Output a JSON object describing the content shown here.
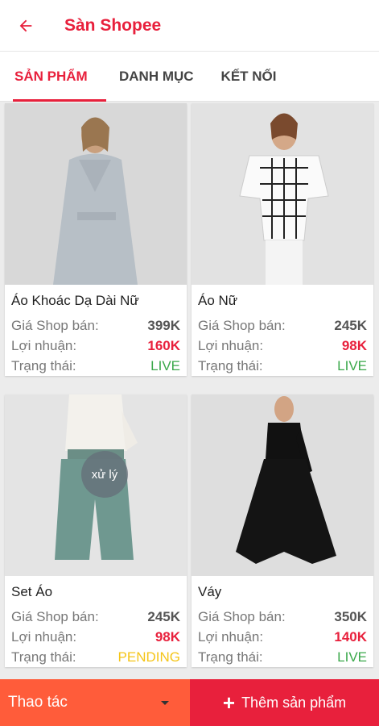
{
  "header": {
    "title": "Sàn Shopee"
  },
  "tabs": [
    {
      "label": "SẢN PHẨM"
    },
    {
      "label": "DANH MỤC"
    },
    {
      "label": "KẾT NỐI"
    }
  ],
  "products": [
    {
      "name": "Áo Khoác Dạ Dài Nữ",
      "price_label": "Giá Shop bán:",
      "price": "399K",
      "profit_label": "Lợi nhuận:",
      "profit": "160K",
      "status_label": "Trạng thái:",
      "status": "LIVE"
    },
    {
      "name": "Áo Nữ",
      "price_label": "Giá Shop bán:",
      "price": "245K",
      "profit_label": "Lợi nhuận:",
      "profit": "98K",
      "status_label": "Trạng thái:",
      "status": "LIVE"
    },
    {
      "name": "Set Áo",
      "price_label": "Giá Shop bán:",
      "price": "245K",
      "profit_label": "Lợi nhuận:",
      "profit": "98K",
      "status_label": "Trạng thái:",
      "status": "PENDING",
      "overlay": "xử lý"
    },
    {
      "name": "Váy",
      "price_label": "Giá Shop bán:",
      "price": "350K",
      "profit_label": "Lợi nhuận:",
      "profit": "140K",
      "status_label": "Trạng thái:",
      "status": "LIVE"
    }
  ],
  "footer": {
    "action_label": "Thao tác",
    "add_label": "Thêm sản phẩm"
  },
  "colors": {
    "primary": "#e8203c",
    "action": "#ff5c3a",
    "live": "#3aa84a",
    "pending": "#f5c518"
  }
}
